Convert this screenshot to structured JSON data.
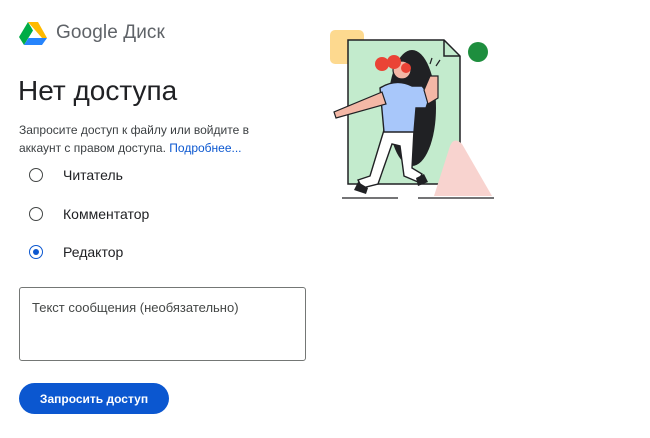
{
  "header": {
    "logo_text": "Google Диск",
    "logo_icon": "google-drive-icon"
  },
  "page": {
    "title": "Нет доступа",
    "description": "Запросите доступ к файлу или войдите в аккаунт с правом доступа.",
    "learn_more": "Подробнее..."
  },
  "roles": [
    {
      "label": "Читатель",
      "checked": false
    },
    {
      "label": "Комментатор",
      "checked": false
    },
    {
      "label": "Редактор",
      "checked": true
    }
  ],
  "message": {
    "placeholder": "Текст сообщения (необязательно)",
    "value": ""
  },
  "actions": {
    "request_label": "Запросить доступ"
  },
  "colors": {
    "accent": "#0b57d0",
    "title": "#202124",
    "text": "#3c4043"
  }
}
